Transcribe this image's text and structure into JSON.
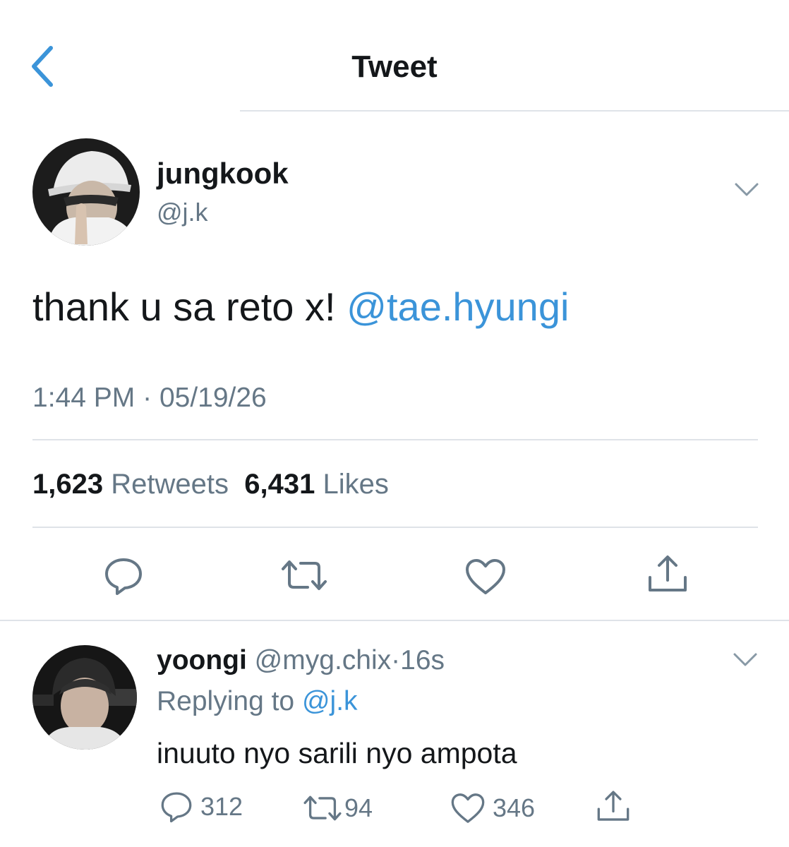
{
  "header": {
    "title": "Tweet"
  },
  "tweet": {
    "author_name": "jungkook",
    "author_handle": "@j.k",
    "text": "thank u sa reto x!",
    "mention": "@tae.hyungi",
    "time": "1:44 PM",
    "separator": "·",
    "date": "05/19/26",
    "retweets_count": "1,623",
    "retweets_label": "Retweets",
    "likes_count": "6,431",
    "likes_label": "Likes"
  },
  "reply": {
    "author_name": "yoongi",
    "author_handle": "@myg.chix",
    "separator": "·",
    "time": "16s",
    "replying_to_label": "Replying to",
    "replying_to_handle": "@j.k",
    "text": "inuuto nyo sarili nyo ampota",
    "reply_count": "312",
    "retweet_count": "94",
    "like_count": "346"
  },
  "colors": {
    "text": "#14171a",
    "secondary": "#657786",
    "accent": "#3b94d9",
    "divider": "#dfe3e8"
  },
  "icons": {
    "back": "chevron-left-icon",
    "more": "chevron-down-icon",
    "reply": "speech-bubble-icon",
    "retweet": "retweet-icon",
    "like": "heart-icon",
    "share": "share-icon"
  }
}
